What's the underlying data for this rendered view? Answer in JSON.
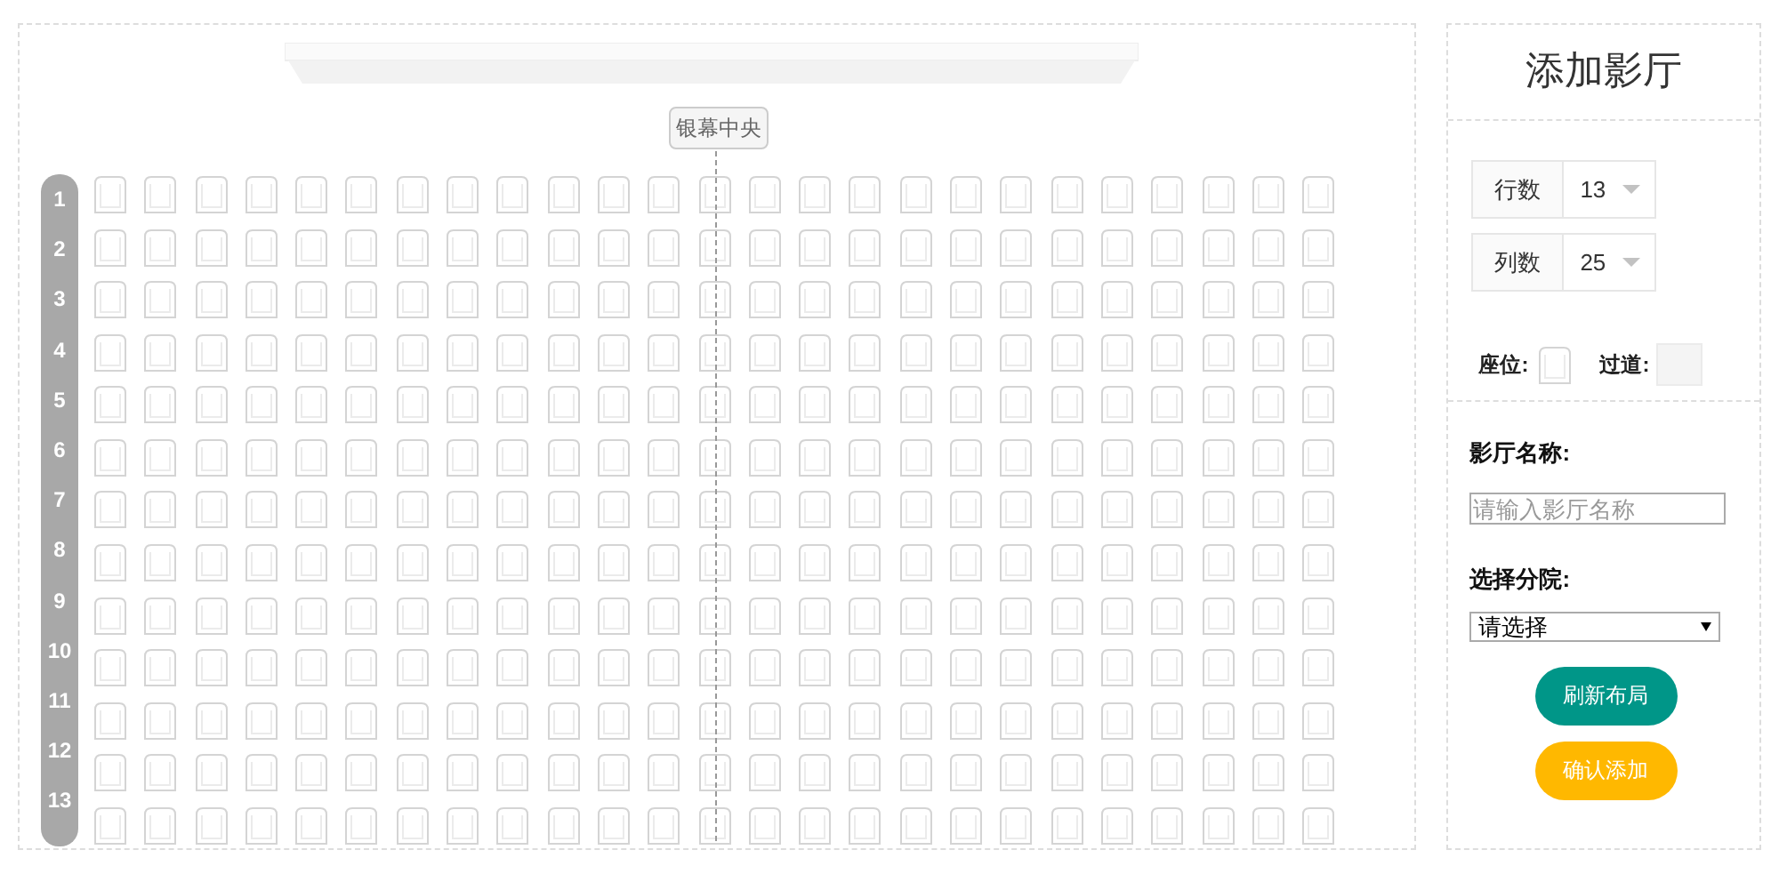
{
  "seat_map": {
    "screen_center_label": "银幕中央",
    "row_labels": [
      "1",
      "2",
      "3",
      "4",
      "5",
      "6",
      "7",
      "8",
      "9",
      "10",
      "11",
      "12",
      "13"
    ]
  },
  "panel": {
    "title": "添加影厅",
    "rows_select": {
      "label": "行数",
      "value": "13"
    },
    "columns_select": {
      "label": "列数",
      "value": "25"
    },
    "legend": [
      {
        "kind": "seat",
        "label": "座位:"
      },
      {
        "kind": "aisle",
        "label": "过道:"
      }
    ],
    "hall_name": {
      "label": "影厅名称:",
      "placeholder": "请输入影厅名称"
    },
    "branch": {
      "label": "选择分院:",
      "value": "请选择"
    },
    "buttons": [
      {
        "label": "刷新布局",
        "color": "#009688"
      },
      {
        "label": "确认添加",
        "color": "#ffb800"
      }
    ]
  }
}
